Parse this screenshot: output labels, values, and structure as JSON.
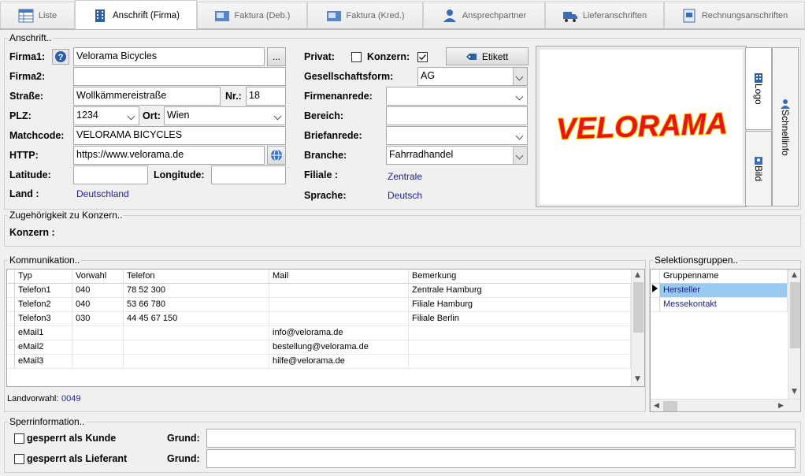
{
  "tabs": [
    {
      "label": "Liste"
    },
    {
      "label": "Anschrift (Firma)"
    },
    {
      "label": "Faktura (Deb.)"
    },
    {
      "label": "Faktura (Kred.)"
    },
    {
      "label": "Ansprechpartner"
    },
    {
      "label": "Lieferanschriften"
    },
    {
      "label": "Rechnungsanschriften"
    }
  ],
  "anschrift": {
    "legend": "Anschrift..",
    "firma1_label": "Firma1:",
    "firma1": "Velorama Bicycles",
    "ellipsis": "...",
    "firma2_label": "Firma2:",
    "firma2": "",
    "strasse_label": "Straße:",
    "strasse": "Wollkämmereistraße",
    "nr_label": "Nr.:",
    "nr": "18",
    "plz_label": "PLZ:",
    "plz": "1234",
    "ort_label": "Ort:",
    "ort": "Wien",
    "matchcode_label": "Matchcode:",
    "matchcode": "VELORAMA BICYCLES",
    "http_label": "HTTP:",
    "http": "https://www.velorama.de",
    "latitude_label": "Latitude:",
    "latitude": "",
    "longitude_label": "Longitude:",
    "longitude": "",
    "land_label": "Land :",
    "land": "Deutschland",
    "privat_label": "Privat:",
    "konzern_label": "Konzern:",
    "privat_checked": false,
    "konzern_checked": true,
    "etikett_label": "Etikett",
    "gesellschaftsform_label": "Gesellschaftsform:",
    "gesellschaftsform": "AG",
    "firmenanrede_label": "Firmenanrede:",
    "firmenanrede": "",
    "bereich_label": "Bereich:",
    "bereich": "",
    "briefanrede_label": "Briefanrede:",
    "briefanrede": "",
    "branche_label": "Branche:",
    "branche": "Fahrradhandel",
    "filiale_label": "Filiale :",
    "filiale": "Zentrale",
    "sprache_label": "Sprache:",
    "sprache": "Deutsch",
    "logo_text": "VELORAMA",
    "side_tabs": {
      "logo": "Logo",
      "bild": "Bild",
      "schnellinfo": "Schnellinfo"
    }
  },
  "konzern": {
    "legend": "Zugehörigkeit zu Konzern..",
    "label": "Konzern :",
    "value": ""
  },
  "kommunikation": {
    "legend": "Kommunikation..",
    "columns": [
      "Typ",
      "Vorwahl",
      "Telefon",
      "Mail",
      "Bemerkung"
    ],
    "rows": [
      [
        "Telefon1",
        "040",
        "78 52 300",
        "",
        "Zentrale Hamburg"
      ],
      [
        "Telefon2",
        "040",
        "53 66 780",
        "",
        "Filiale Hamburg"
      ],
      [
        "Telefon3",
        "030",
        "44 45 67 150",
        "",
        "Filiale Berlin"
      ],
      [
        "eMail1",
        "",
        "",
        "info@velorama.de",
        ""
      ],
      [
        "eMail2",
        "",
        "",
        "bestellung@velorama.de",
        ""
      ],
      [
        "eMail3",
        "",
        "",
        "hilfe@velorama.de",
        ""
      ]
    ],
    "landvorwahl_label": "Landvorwahl:",
    "landvorwahl": "0049"
  },
  "selektion": {
    "legend": "Selektionsgruppen..",
    "column": "Gruppenname",
    "rows": [
      "Hersteller",
      "Messekontakt"
    ]
  },
  "sperr": {
    "legend": "Sperrinformation..",
    "kunde_label": "gesperrt als Kunde",
    "lieferant_label": "gesperrt als Lieferant",
    "grund_label": "Grund:",
    "grund_kunde": "",
    "grund_lieferant": ""
  },
  "colors": {
    "selection": "#99c9ef",
    "link": "#1f1f8f",
    "logo_red": "#e8141b",
    "logo_yellow": "#ffd400"
  }
}
